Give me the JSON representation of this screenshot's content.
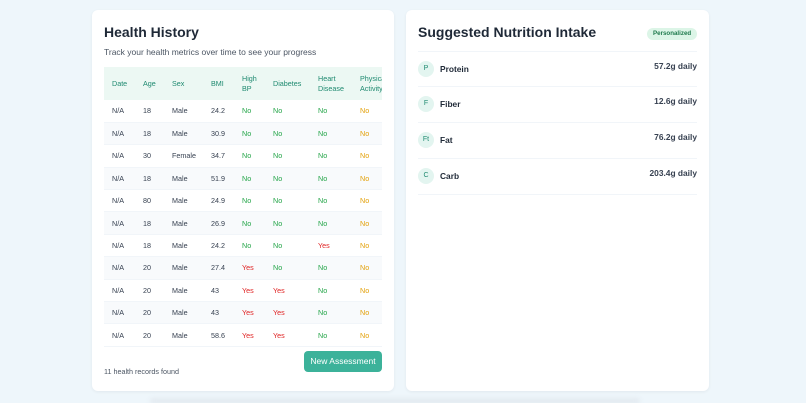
{
  "history": {
    "title": "Health History",
    "subtitle": "Track your health metrics over time to see your progress",
    "columns": [
      "Date",
      "Age",
      "Sex",
      "BMI",
      "High BP",
      "Diabetes",
      "Heart Disease",
      "Physical Activity"
    ],
    "rows": [
      [
        "N/A",
        "18",
        "Male",
        "24.2",
        "No",
        "No",
        "No",
        "No"
      ],
      [
        "N/A",
        "18",
        "Male",
        "30.9",
        "No",
        "No",
        "No",
        "No"
      ],
      [
        "N/A",
        "30",
        "Female",
        "34.7",
        "No",
        "No",
        "No",
        "No"
      ],
      [
        "N/A",
        "18",
        "Male",
        "51.9",
        "No",
        "No",
        "No",
        "No"
      ],
      [
        "N/A",
        "80",
        "Male",
        "24.9",
        "No",
        "No",
        "No",
        "No"
      ],
      [
        "N/A",
        "18",
        "Male",
        "26.9",
        "No",
        "No",
        "No",
        "No"
      ],
      [
        "N/A",
        "18",
        "Male",
        "24.2",
        "No",
        "No",
        "Yes",
        "No"
      ],
      [
        "N/A",
        "20",
        "Male",
        "27.4",
        "Yes",
        "No",
        "No",
        "No"
      ],
      [
        "N/A",
        "20",
        "Male",
        "43",
        "Yes",
        "Yes",
        "No",
        "No"
      ],
      [
        "N/A",
        "20",
        "Male",
        "43",
        "Yes",
        "Yes",
        "No",
        "No"
      ],
      [
        "N/A",
        "20",
        "Male",
        "58.6",
        "Yes",
        "Yes",
        "No",
        "No"
      ]
    ],
    "records_count": "11 health records found",
    "new_assessment_label": "New Assessment"
  },
  "nutrition": {
    "title": "Suggested Nutrition Intake",
    "badge": "Personalized",
    "items": [
      {
        "initial": "P",
        "name": "Protein",
        "amount": "57.2g daily"
      },
      {
        "initial": "F",
        "name": "Fiber",
        "amount": "12.6g daily"
      },
      {
        "initial": "Ft",
        "name": "Fat",
        "amount": "76.2g daily"
      },
      {
        "initial": "C",
        "name": "Carb",
        "amount": "203.4g daily"
      }
    ]
  },
  "colors": {
    "accent": "#3cb29a",
    "no": "#22a447",
    "yes": "#e02424",
    "activity": "#e3a008"
  }
}
